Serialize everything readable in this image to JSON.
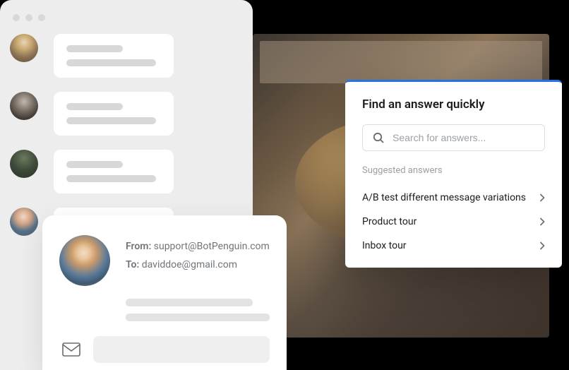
{
  "email": {
    "from_label": "From:",
    "from_value": "support@BotPenguin.com",
    "to_label": "To:",
    "to_value": "daviddoe@gmail.com"
  },
  "answer_panel": {
    "title": "Find an answer quickly",
    "search_placeholder": "Search for answers...",
    "suggested_label": "Suggested answers",
    "suggestions": [
      "A/B test different message variations",
      "Product tour",
      "Inbox tour"
    ]
  }
}
